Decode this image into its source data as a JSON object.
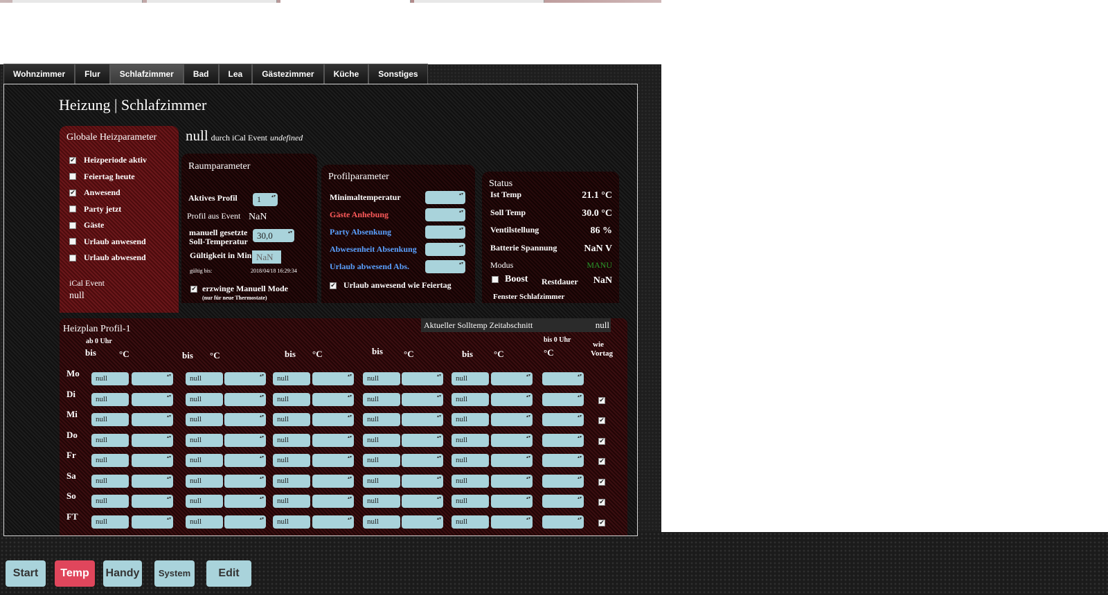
{
  "tabs": [
    "Wohnzimmer",
    "Flur",
    "Schlafzimmer",
    "Bad",
    "Lea",
    "Gästezimmer",
    "Küche",
    "Sonstiges"
  ],
  "active_tab": "Schlafzimmer",
  "heading": "Heizung | Schlafzimmer",
  "global": {
    "title": "Globale Heizparameter",
    "items": [
      {
        "label": "Heizperiode aktiv",
        "checked": true
      },
      {
        "label": "Feiertag heute",
        "checked": false
      },
      {
        "label": "Anwesend",
        "checked": true
      },
      {
        "label": "Party jetzt",
        "checked": false
      },
      {
        "label": "Gäste",
        "checked": false
      },
      {
        "label": "Urlaub anwesend",
        "checked": false
      },
      {
        "label": "Urlaub abwesend",
        "checked": false
      }
    ],
    "ical_label": "iCal Event",
    "ical_value": "null"
  },
  "event_line": {
    "main": "null",
    "mid": "durch iCal Event",
    "italic": "undefined"
  },
  "raum": {
    "title": "Raumparameter",
    "aktives_profil_label": "Aktives Profil",
    "aktives_profil_value": "1",
    "profil_event_label": "Profil aus Event",
    "profil_event_value": "NaN",
    "manuell_label_1": "manuell gesetzte",
    "manuell_label_2": "Soll-Temperatur",
    "manuell_value": "30,0",
    "gueltig_label": "Gültigkeit in Min",
    "gueltig_value": "NaN",
    "gueltig_bis_label": "gültig bis:",
    "gueltig_bis_value": "2018/04/18 16:29:34",
    "erzwinge_label": "erzwinge Manuell Mode",
    "erzwinge_sub": "(nur für neue Thermostate)",
    "erzwinge_checked": true
  },
  "profil": {
    "title": "Profilparameter",
    "items": [
      {
        "label": "Minimaltemperatur",
        "color": "#ffffff"
      },
      {
        "label": "Gäste Anhebung",
        "color": "#ff5a5a"
      },
      {
        "label": "Party Absenkung",
        "color": "#5aa0ff"
      },
      {
        "label": "Abwesenheit Absenkung",
        "color": "#5aa0ff"
      },
      {
        "label": "Urlaub abwesend Abs.",
        "color": "#5aa0ff"
      }
    ],
    "urlaub_label": "Urlaub anwesend wie Feiertag",
    "urlaub_checked": true
  },
  "status": {
    "title": "Status",
    "rows": [
      {
        "label": "Ist Temp",
        "value": "21.1 °C"
      },
      {
        "label": "Soll Temp",
        "value": "30.0 °C"
      },
      {
        "label": "Ventilstellung",
        "value": "86 %"
      },
      {
        "label": "Batterie Spannung",
        "value": "NaN V"
      }
    ],
    "modus_label": "Modus",
    "modus_value": "MANU",
    "modus_color": "#2a9a2a",
    "boost_label": "Boost",
    "restdauer_label": "Restdauer",
    "restdauer_value": "NaN",
    "fenster_label": "Fenster Schlafzimmer"
  },
  "heizplan": {
    "title": "Heizplan Profil-1",
    "aktuell_label": "Aktueller Solltemp Zeitabschnitt",
    "aktuell_value": "null",
    "col_ab0": "ab 0 Uhr",
    "col_bis": "bis",
    "col_deg": "°C",
    "col_bis0": "bis 0 Uhr",
    "col_wie": "wie",
    "col_vortag": "Vortag",
    "days": [
      {
        "day": "Mo",
        "wie": null
      },
      {
        "day": "Di",
        "wie": true
      },
      {
        "day": "Mi",
        "wie": true
      },
      {
        "day": "Do",
        "wie": true
      },
      {
        "day": "Fr",
        "wie": true
      },
      {
        "day": "Sa",
        "wie": true
      },
      {
        "day": "So",
        "wie": true
      },
      {
        "day": "FT",
        "wie": true
      }
    ],
    "cell": "null"
  },
  "bottom_buttons": [
    {
      "label": "Start",
      "active": false
    },
    {
      "label": "Temp",
      "active": true
    },
    {
      "label": "Handy",
      "active": false
    },
    {
      "label": "System",
      "active": false
    },
    {
      "label": "Edit",
      "active": false
    }
  ],
  "colors": {
    "accent_red": "#e0465c",
    "button": "#a9d3db"
  }
}
